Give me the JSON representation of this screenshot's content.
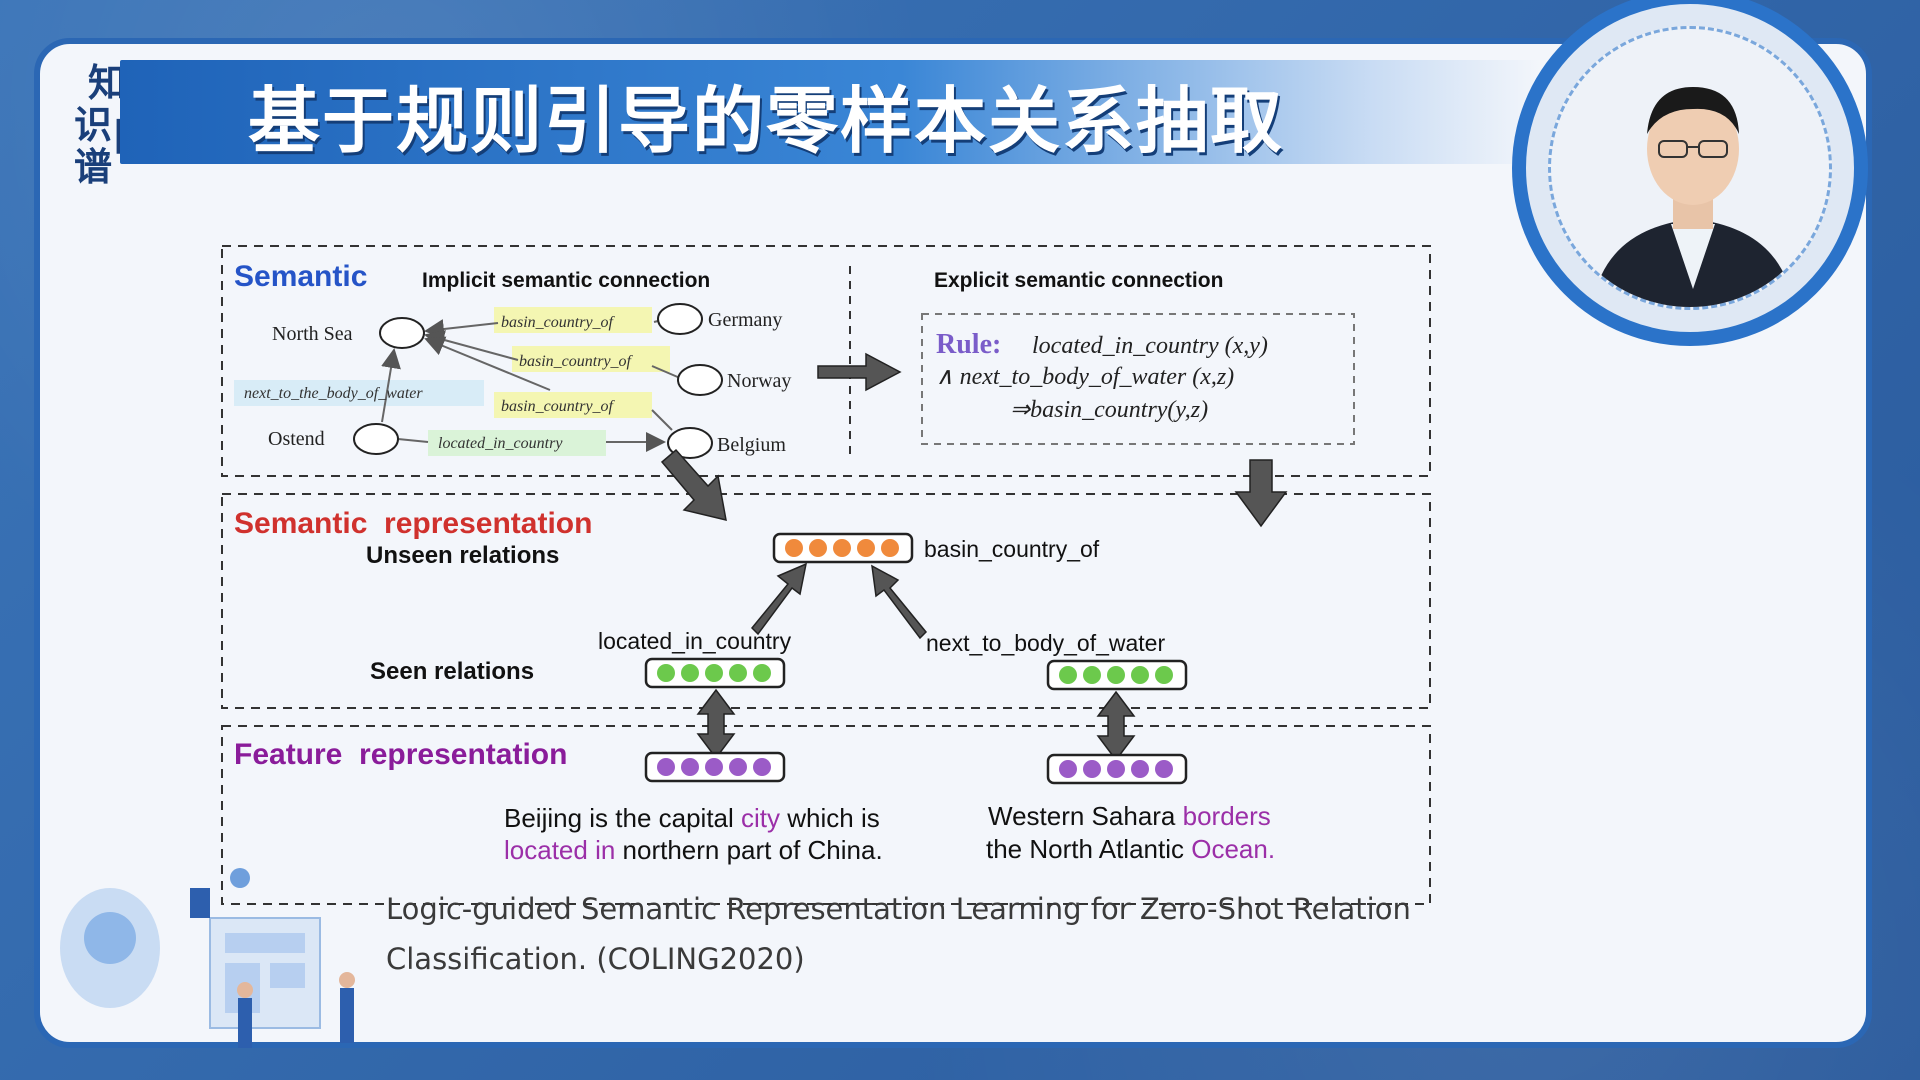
{
  "header": {
    "logo_chars": [
      "知",
      "识",
      "图",
      "谱"
    ],
    "title": "基于规则引导的零样本关系抽取"
  },
  "semantic": {
    "heading": "Semantic",
    "implicit_label": "Implicit semantic connection",
    "explicit_label": "Explicit semantic connection",
    "nodes": {
      "north_sea": "North Sea",
      "ostend": "Ostend",
      "germany": "Germany",
      "norway": "Norway",
      "belgium": "Belgium"
    },
    "edges": {
      "basin1": "basin_country_of",
      "basin2": "basin_country_of",
      "basin3": "basin_country_of",
      "next_to": "next_to_the_body_of_water",
      "located": "located_in_country"
    },
    "rule": {
      "keyword": "Rule:",
      "line1": "located_in_country (x,y)",
      "line2": "∧ next_to_body_of_water (x,z)",
      "line3": "⇒basin_country(y,z)"
    }
  },
  "representation": {
    "heading": "Semantic  representation",
    "unseen": "Unseen relations",
    "seen": "Seen relations",
    "target": "basin_country_of",
    "left_relation": "located_in_country",
    "right_relation": "next_to_body_of_water"
  },
  "feature": {
    "heading": "Feature  representation",
    "sentence1_a": "Beijing is the capital ",
    "sentence1_b": "city",
    "sentence1_c": " which is",
    "sentence1_d": "located in",
    "sentence1_e": " northern part of China.",
    "sentence2_a": "Western Sahara ",
    "sentence2_b": "borders",
    "sentence2_c": "the North Atlantic ",
    "sentence2_d": "Ocean."
  },
  "citation": {
    "line1": "Logic-guided Semantic Representation Learning for Zero-Shot Relation",
    "line2": "Classification. (COLING2020)"
  },
  "colors": {
    "blue_heading": "#2554c7",
    "red_heading": "#d0312d",
    "purple_heading": "#8a1c9a",
    "orange_dot": "#f08a3c",
    "green_dot": "#6cc94c",
    "purple_dot": "#9b5bc7",
    "purple_text": "#9b2fa8"
  }
}
